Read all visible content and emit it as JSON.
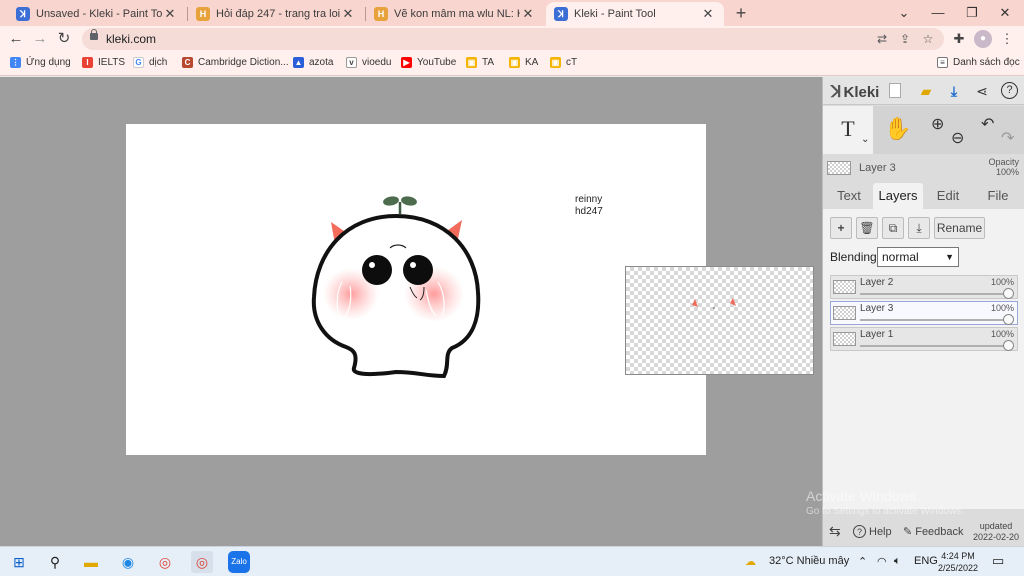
{
  "browser": {
    "tabs": [
      {
        "title": "Unsaved - Kleki - Paint Tool",
        "active": false
      },
      {
        "title": "Hỏi đáp 247 - trang tra loi",
        "active": false
      },
      {
        "title": "Vẽ kon mâm ma wlu NL: Hãy viết",
        "active": false
      },
      {
        "title": "Kleki - Paint Tool",
        "active": true
      }
    ],
    "tab_close": "✕",
    "new_tab": "+",
    "window_controls": [
      "⌄",
      "—",
      "❐",
      "✕"
    ],
    "url": "kleki.com",
    "bookmarks": [
      "Ứng dụng",
      "IELTS",
      "dịch",
      "Cambridge Diction...",
      "azota",
      "vioedu",
      "YouTube",
      "TA",
      "KA",
      "cT"
    ],
    "reading_list": "Danh sách đọc"
  },
  "canvas": {
    "text_line1": "reinny",
    "text_line2": "hd247"
  },
  "kleki": {
    "logo": "Kleki",
    "current_layer": "Layer 3",
    "opacity_label": "Opacity",
    "opacity_value": "100%",
    "tabs": [
      "Text",
      "Layers",
      "Edit",
      "File"
    ],
    "active_tab": "Layers",
    "layer_buttons": [
      "+",
      "🗑",
      "⧉",
      "⤓"
    ],
    "rename_label": "Rename",
    "blending_label": "Blending",
    "blending_value": "normal",
    "layers": [
      {
        "name": "Layer 2",
        "opacity": "100%",
        "selected": false
      },
      {
        "name": "Layer 3",
        "opacity": "100%",
        "selected": true
      },
      {
        "name": "Layer 1",
        "opacity": "100%",
        "selected": false
      }
    ],
    "footer": {
      "help": "Help",
      "feedback": "Feedback",
      "updated_label": "updated",
      "updated_date": "2022-02-20"
    }
  },
  "watermark": {
    "line1": "Activate Windows",
    "line2": "Go to Settings to activate Windows."
  },
  "taskbar": {
    "weather": "32°C  Nhiều mây",
    "lang": "ENG",
    "time": "4:24 PM",
    "date": "2/25/2022"
  },
  "colors": {
    "tab_strip": "#f9d5cf",
    "toolbar": "#fff0ed",
    "workspace": "#9e9e9e",
    "panel": "#dcdcdc",
    "horn": "#f26b5b"
  }
}
